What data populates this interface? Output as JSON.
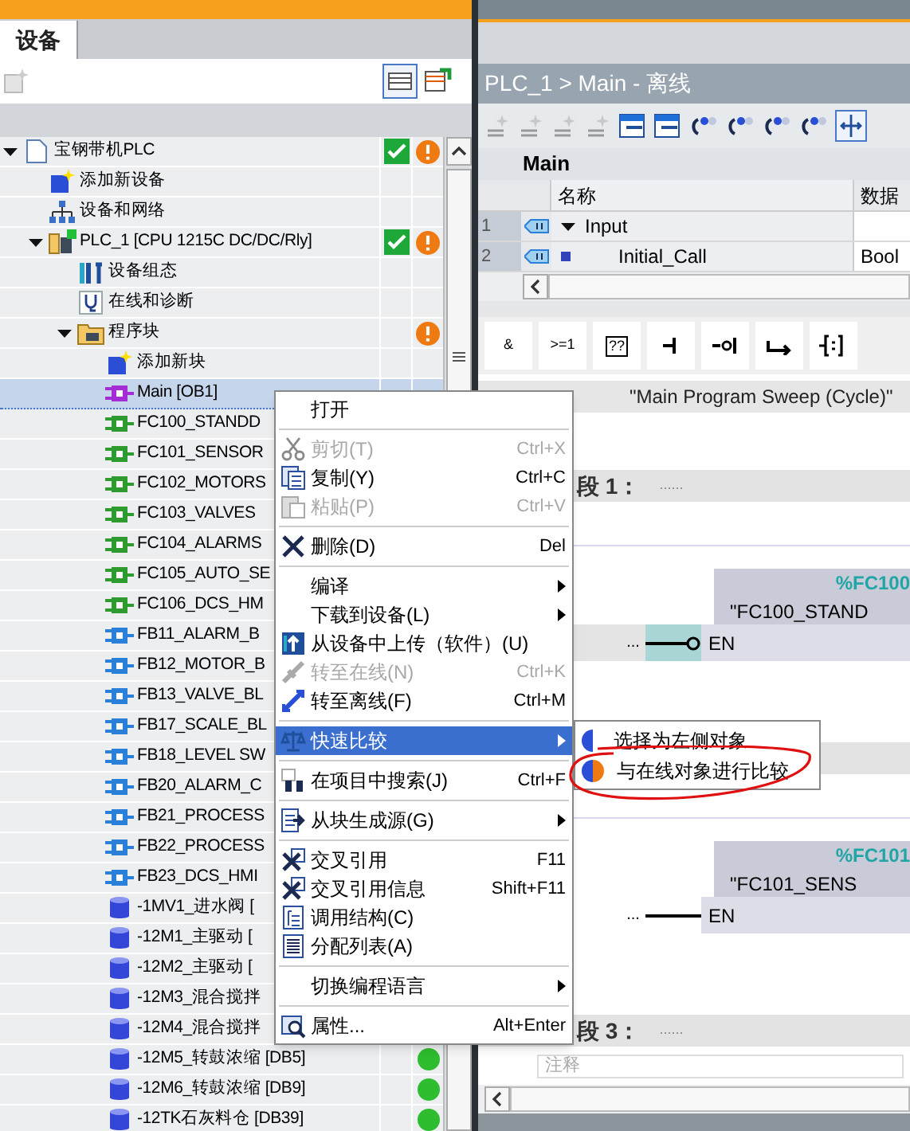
{
  "project_tree": {
    "tab": "设备",
    "items": [
      {
        "label": "宝钢带机PLC",
        "kind": "project",
        "expanded": true,
        "selected": false,
        "consistent": true,
        "warning": true,
        "children": [
          {
            "label": "添加新设备",
            "kind": "add",
            "selected": false
          },
          {
            "label": "设备和网络",
            "kind": "network",
            "selected": false
          },
          {
            "label": "PLC_1 [CPU 1215C DC/DC/Rly]",
            "kind": "plc",
            "expanded": true,
            "selected": false,
            "consistent": true,
            "warning": true,
            "children": [
              {
                "label": "设备组态",
                "kind": "config",
                "selected": false
              },
              {
                "label": "在线和诊断",
                "kind": "diag",
                "selected": false
              },
              {
                "label": "程序块",
                "kind": "folder",
                "expanded": true,
                "selected": false,
                "warning": true,
                "children": [
                  {
                    "label": "添加新块",
                    "kind": "add",
                    "selected": false
                  },
                  {
                    "label": "Main [OB1]",
                    "kind": "ob",
                    "selected": true
                  },
                  {
                    "label": "FC100_STANDD",
                    "kind": "fc",
                    "selected": false
                  },
                  {
                    "label": "FC101_SENSOR",
                    "kind": "fc",
                    "selected": false
                  },
                  {
                    "label": "FC102_MOTORS",
                    "kind": "fc",
                    "selected": false
                  },
                  {
                    "label": "FC103_VALVES",
                    "kind": "fc",
                    "selected": false
                  },
                  {
                    "label": "FC104_ALARMS",
                    "kind": "fc",
                    "selected": false
                  },
                  {
                    "label": "FC105_AUTO_SE",
                    "kind": "fc",
                    "selected": false
                  },
                  {
                    "label": "FC106_DCS_HM",
                    "kind": "fc",
                    "selected": false
                  },
                  {
                    "label": "FB11_ALARM_B",
                    "kind": "fb",
                    "selected": false
                  },
                  {
                    "label": "FB12_MOTOR_B",
                    "kind": "fb",
                    "selected": false
                  },
                  {
                    "label": "FB13_VALVE_BL",
                    "kind": "fb",
                    "selected": false
                  },
                  {
                    "label": "FB17_SCALE_BL",
                    "kind": "fb",
                    "selected": false
                  },
                  {
                    "label": "FB18_LEVEL SW",
                    "kind": "fb",
                    "selected": false
                  },
                  {
                    "label": "FB20_ALARM_C",
                    "kind": "fb",
                    "selected": false
                  },
                  {
                    "label": "FB21_PROCESS",
                    "kind": "fb",
                    "selected": false
                  },
                  {
                    "label": "FB22_PROCESS",
                    "kind": "fb",
                    "selected": false
                  },
                  {
                    "label": "FB23_DCS_HMI",
                    "kind": "fb",
                    "selected": false
                  },
                  {
                    "label": "-1MV1_进水阀 [",
                    "kind": "db",
                    "selected": false
                  },
                  {
                    "label": "-12M1_主驱动 [",
                    "kind": "db",
                    "selected": false
                  },
                  {
                    "label": "-12M2_主驱动 [",
                    "kind": "db",
                    "selected": false
                  },
                  {
                    "label": "-12M3_混合搅拌",
                    "kind": "db",
                    "selected": false
                  },
                  {
                    "label": "-12M4_混合搅拌",
                    "kind": "db",
                    "selected": false
                  },
                  {
                    "label": "-12M5_转鼓浓缩 [DB5]",
                    "kind": "db",
                    "selected": false,
                    "online": true
                  },
                  {
                    "label": "-12M6_转鼓浓缩 [DB9]",
                    "kind": "db",
                    "selected": false,
                    "online": true
                  },
                  {
                    "label": "-12TK石灰料仓 [DB39]",
                    "kind": "db",
                    "selected": false,
                    "online": true
                  }
                ]
              }
            ]
          }
        ]
      }
    ]
  },
  "editor": {
    "breadcrumb": "PLC_1 > Main - 离线",
    "block_name": "Main",
    "interface": {
      "columns": [
        "名称",
        "数据"
      ],
      "rows": [
        {
          "index": "1",
          "name": "Input",
          "kind": "section",
          "expanded": true
        },
        {
          "index": "2",
          "name": "Initial_Call",
          "kind": "param",
          "data_type": "Bool"
        }
      ]
    },
    "instructions": [
      {
        "kind": "text",
        "label": "&"
      },
      {
        "kind": "text",
        "label": ">=1"
      },
      {
        "kind": "box",
        "label": "??"
      },
      {
        "kind": "no_contact"
      },
      {
        "kind": "nc_contact"
      },
      {
        "kind": "branch"
      },
      {
        "kind": "assign"
      }
    ],
    "block_title": "\"Main Program Sweep (Cycle)\"",
    "networks": [
      {
        "label": "段 1：",
        "comment": "......",
        "call": {
          "wire": "...",
          "address": "%FC100",
          "name": "\"FC100_STAND",
          "input": "EN",
          "negated": true
        }
      },
      {
        "call": {
          "wire": "...",
          "address": "%FC101",
          "name": "\"FC101_SENS",
          "input": "EN",
          "negated": false
        }
      },
      {
        "label": "段 3：",
        "comment": "......",
        "comment_placeholder": "注释"
      }
    ]
  },
  "context_menu": {
    "items": [
      {
        "kind": "item",
        "label": "打开",
        "disabled": false
      },
      {
        "kind": "separator"
      },
      {
        "kind": "item",
        "label": "剪切(T)",
        "shortcut": "Ctrl+X",
        "disabled": true
      },
      {
        "kind": "item",
        "label": "复制(Y)",
        "shortcut": "Ctrl+C",
        "disabled": false
      },
      {
        "kind": "item",
        "label": "粘贴(P)",
        "shortcut": "Ctrl+V",
        "disabled": true
      },
      {
        "kind": "separator"
      },
      {
        "kind": "item",
        "label": "删除(D)",
        "shortcut": "Del",
        "disabled": false
      },
      {
        "kind": "separator"
      },
      {
        "kind": "item",
        "label": "编译",
        "submenu": true,
        "disabled": false
      },
      {
        "kind": "item",
        "label": "下载到设备(L)",
        "submenu": true,
        "disabled": false
      },
      {
        "kind": "item",
        "label": "从设备中上传（软件）(U)",
        "disabled": false
      },
      {
        "kind": "item",
        "label": "转至在线(N)",
        "shortcut": "Ctrl+K",
        "disabled": true
      },
      {
        "kind": "item",
        "label": "转至离线(F)",
        "shortcut": "Ctrl+M",
        "disabled": false
      },
      {
        "kind": "separator"
      },
      {
        "kind": "item",
        "label": "快速比较",
        "submenu": true,
        "disabled": false,
        "selected": true
      },
      {
        "kind": "separator"
      },
      {
        "kind": "item",
        "label": "在项目中搜索(J)",
        "shortcut": "Ctrl+F",
        "disabled": false
      },
      {
        "kind": "separator"
      },
      {
        "kind": "item",
        "label": "从块生成源(G)",
        "submenu": true,
        "disabled": false
      },
      {
        "kind": "separator"
      },
      {
        "kind": "item",
        "label": "交叉引用",
        "shortcut": "F11",
        "disabled": false
      },
      {
        "kind": "item",
        "label": "交叉引用信息",
        "shortcut": "Shift+F11",
        "disabled": false
      },
      {
        "kind": "item",
        "label": "调用结构(C)",
        "disabled": false
      },
      {
        "kind": "item",
        "label": "分配列表(A)",
        "disabled": false
      },
      {
        "kind": "separator"
      },
      {
        "kind": "item",
        "label": "切换编程语言",
        "submenu": true,
        "disabled": false
      },
      {
        "kind": "separator"
      },
      {
        "kind": "item",
        "label": "属性...",
        "shortcut": "Alt+Enter",
        "disabled": false
      }
    ]
  },
  "submenu": {
    "items": [
      {
        "label": "选择为左侧对象",
        "kind": "left",
        "circled": false
      },
      {
        "label": "与在线对象进行比较",
        "kind": "online",
        "circled": true
      }
    ]
  }
}
